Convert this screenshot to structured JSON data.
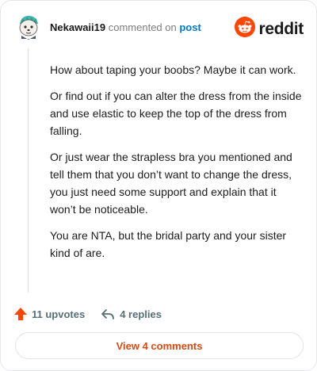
{
  "comment": {
    "username": "Nekawaii19",
    "commented_text": "commented on",
    "post_link": "post",
    "paragraphs": [
      "How about taping your boobs? Maybe it can work.",
      "Or find out if you can alter the dress from the inside and use elastic to keep the top of the dress from falling.",
      "Or just wear the strapless bra you mentioned and tell them that you don’t want to change the dress, you just need some support and explain that it won’t be noticeable.",
      "You are NTA, but the bridal party and your sister kind of are."
    ]
  },
  "brand": {
    "wordmark": "reddit",
    "icon": "reddit-snoo-icon",
    "color": "#ff4500"
  },
  "actions": {
    "upvotes_label": "11 upvotes",
    "upvote_icon": "upvote-arrow-icon",
    "upvote_color": "#ff4500",
    "replies_label": "4 replies",
    "reply_icon": "reply-arrow-icon"
  },
  "footer": {
    "view_comments_label": "View 4 comments",
    "accent_color": "#d94a12"
  }
}
